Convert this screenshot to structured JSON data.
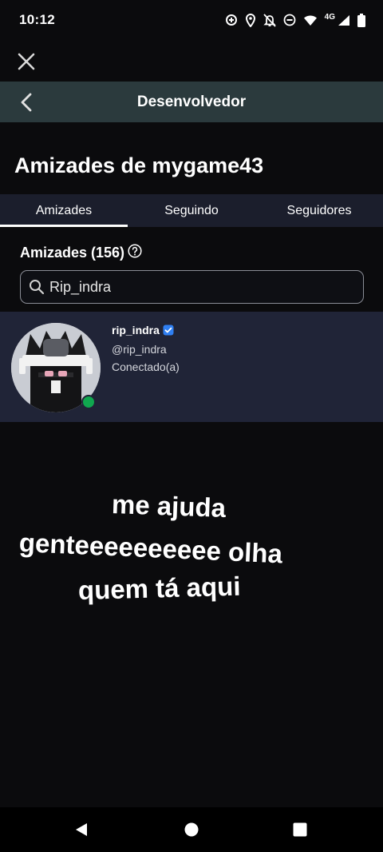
{
  "status_bar": {
    "time": "10:12",
    "network": "4G",
    "icons": [
      "data-saver-icon",
      "location-icon",
      "notifications-off-icon",
      "do-not-disturb-icon",
      "wifi-icon",
      "signal-icon",
      "battery-icon"
    ]
  },
  "devbar": {
    "title": "Desenvolvedor"
  },
  "page": {
    "title": "Amizades de mygame43"
  },
  "tabs": [
    {
      "label": "Amizades",
      "active": true
    },
    {
      "label": "Seguindo",
      "active": false
    },
    {
      "label": "Seguidores",
      "active": false
    }
  ],
  "section": {
    "title": "Amizades (156)"
  },
  "search": {
    "value": "Rip_indra",
    "placeholder": ""
  },
  "friends": [
    {
      "name": "rip_indra",
      "handle": "@rip_indra",
      "status": "Conectado(a)",
      "verified": true,
      "online": true
    }
  ],
  "overlay_text": [
    "me ajuda",
    "genteeeeeeeeee olha",
    "quem tá aqui"
  ],
  "colors": {
    "background": "#0b0b0d",
    "devbar": "#2b3a3d",
    "tabs": "#1b1e2c",
    "selected_row": "#202437",
    "online": "#10a74f",
    "verified": "#2f7ff2"
  }
}
